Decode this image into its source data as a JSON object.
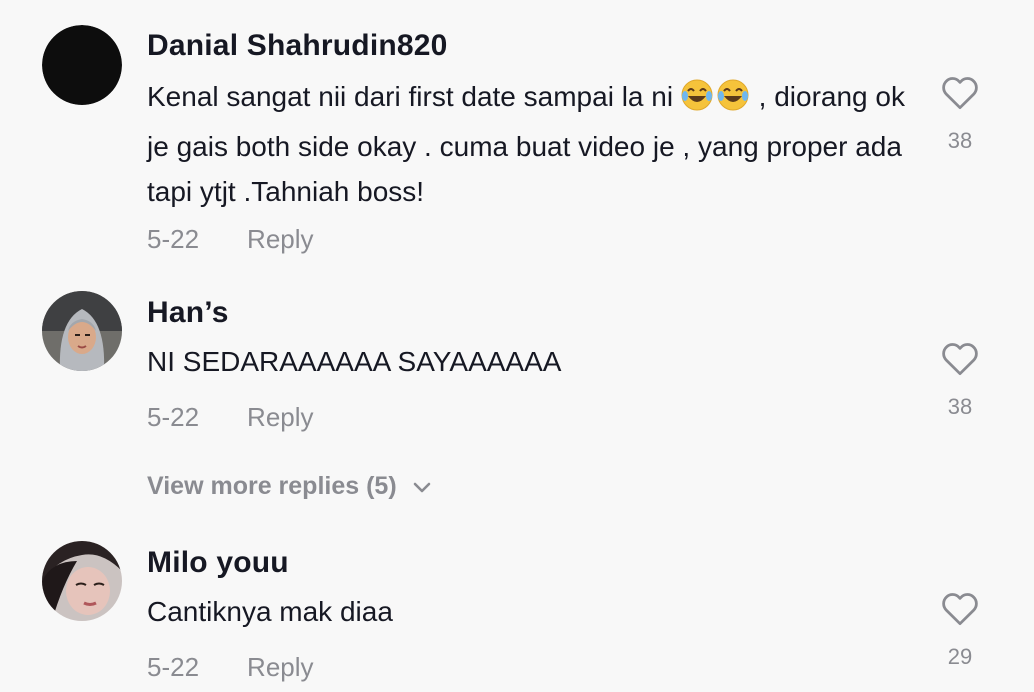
{
  "comments": [
    {
      "username": "Danial Shahrudin820",
      "text_line1": "Kenal sangat nii dari first date sampai la ni",
      "text_emojis": "😂😂",
      "text_line1_end": " ,",
      "text_rest": "diorang ok je gais both side okay . cuma buat video je , yang proper ada tapi ytjt .Tahniah boss!",
      "date": "5-22",
      "reply_label": "Reply",
      "likes": "38"
    },
    {
      "username": "Han’s",
      "text": "NI SEDARAAAAAA SAYAAAAAA",
      "date": "5-22",
      "reply_label": "Reply",
      "likes": "38"
    },
    {
      "username": "Milo youu",
      "text": "Cantiknya mak diaa",
      "date": "5-22",
      "reply_label": "Reply",
      "likes": "29"
    }
  ],
  "view_more_label": "View more replies (5)",
  "icons": {
    "like": "heart-outline-icon",
    "expand": "chevron-down-icon"
  },
  "colors": {
    "background": "#f8f8f8",
    "primary_text": "#161823",
    "secondary_text": "#8a8b91"
  }
}
